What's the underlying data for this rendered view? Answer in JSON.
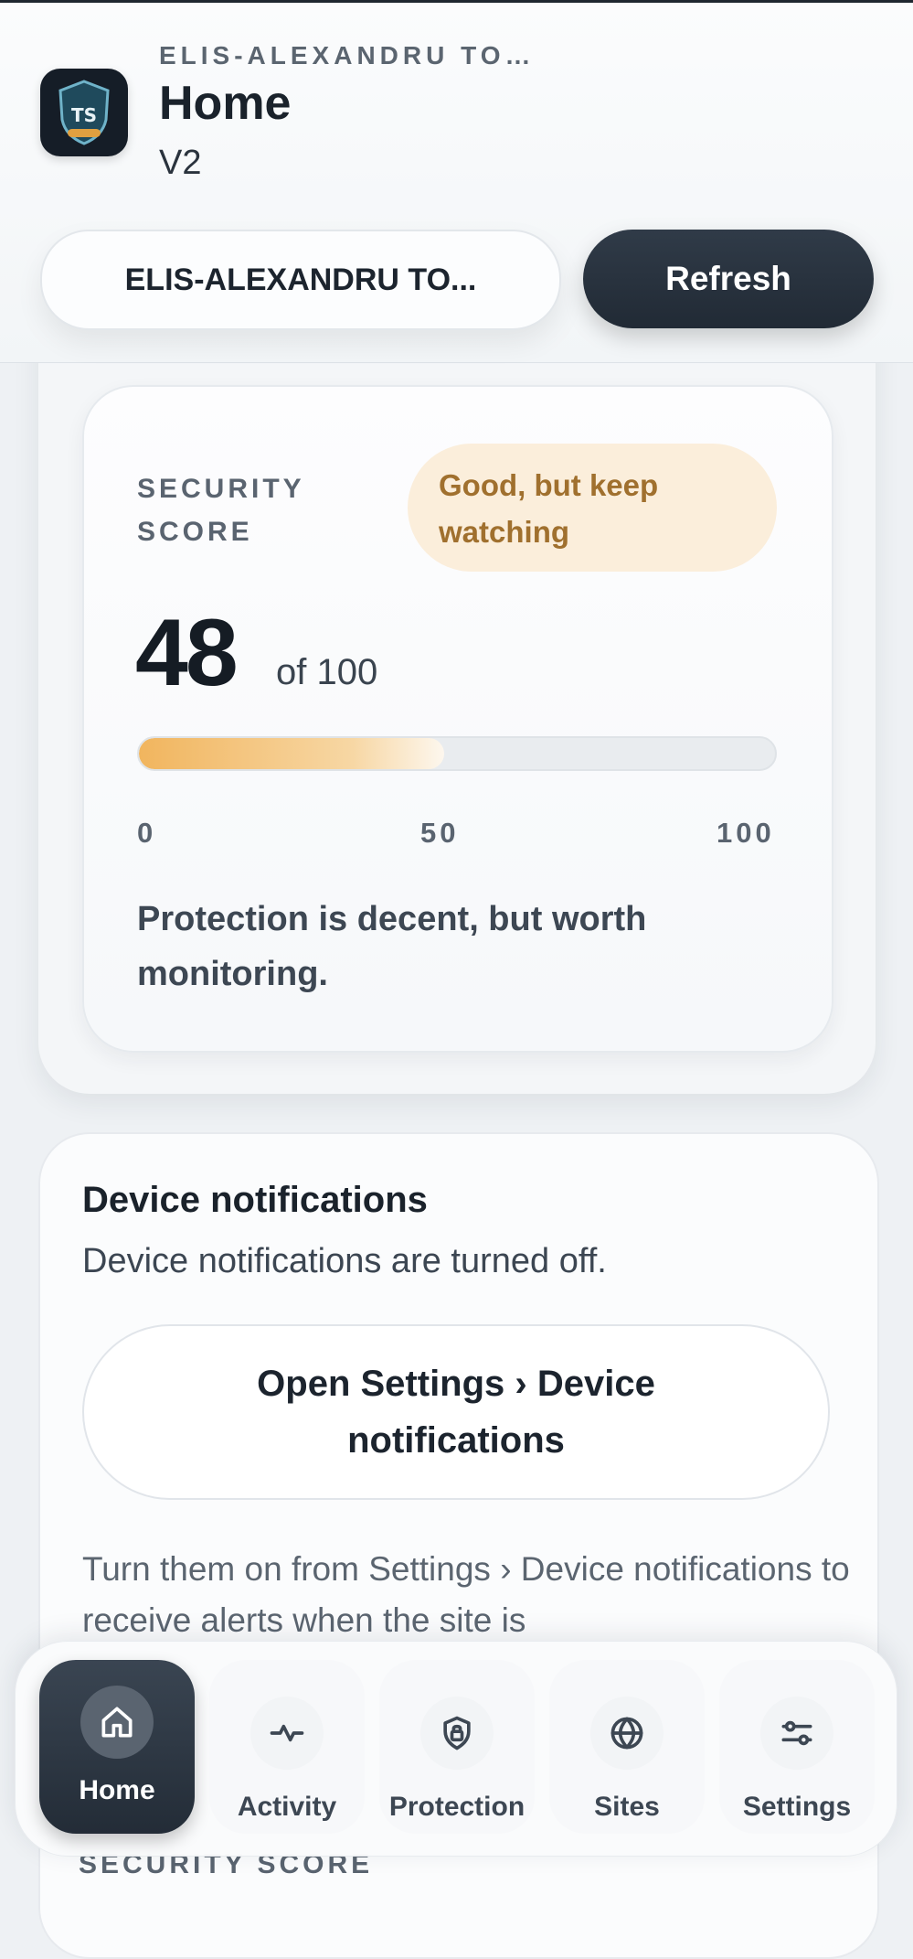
{
  "header": {
    "account_name": "ELIS-ALEXANDRU TO…",
    "title": "Home",
    "version": "V2",
    "logo_text": "TS",
    "profile_button_label": "ELIS-ALEXANDRU TO...",
    "refresh_label": "Refresh"
  },
  "score": {
    "label": "SECURITY SCORE",
    "badge": "Good, but keep watching",
    "value": "48",
    "of_text": "of 100",
    "progress_percent": 48,
    "ticks": [
      "0",
      "50",
      "100"
    ],
    "description": "Protection is decent, but worth monitoring."
  },
  "notifications": {
    "title": "Device notifications",
    "status": "Device notifications are turned off.",
    "button_label": "Open Settings › Device notifications",
    "hint": "Turn them on from Settings › Device notifications to receive alerts when the site is"
  },
  "next_section": {
    "label": "SECURITY SCORE"
  },
  "nav": {
    "items": [
      {
        "label": "Home",
        "icon": "home-icon",
        "active": true
      },
      {
        "label": "Activity",
        "icon": "activity-icon",
        "active": false
      },
      {
        "label": "Protection",
        "icon": "shield-lock-icon",
        "active": false
      },
      {
        "label": "Sites",
        "icon": "globe-icon",
        "active": false
      },
      {
        "label": "Settings",
        "icon": "sliders-icon",
        "active": false
      }
    ]
  },
  "colors": {
    "accent_dark": "#232c37",
    "badge_bg": "#fbeedb",
    "badge_text": "#a0702e",
    "progress": "#f1b55e"
  }
}
